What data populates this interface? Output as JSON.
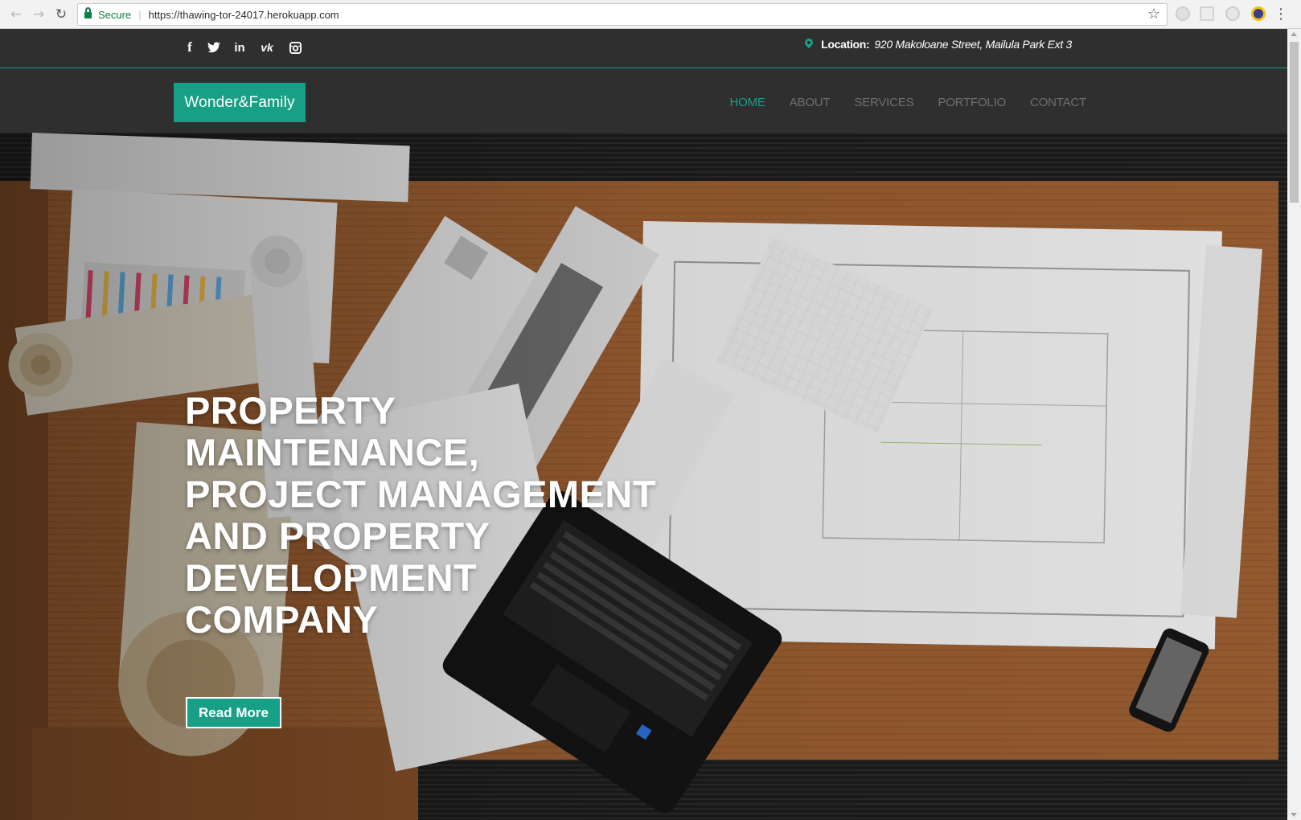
{
  "browser": {
    "secure_label": "Secure",
    "url": "https://thawing-tor-24017.herokuapp.com"
  },
  "topbar": {
    "social": [
      {
        "icon": "facebook-icon",
        "glyph": "f"
      },
      {
        "icon": "twitter-icon",
        "glyph": "🐦"
      },
      {
        "icon": "linkedin-icon",
        "glyph": "in"
      },
      {
        "icon": "vk-icon",
        "glyph": "vk"
      },
      {
        "icon": "instagram-icon",
        "glyph": "◙"
      }
    ],
    "location_label": "Location:",
    "location_value": "920 Makoloane Street, Mailula Park Ext 3"
  },
  "navbar": {
    "brand": "Wonder&Family",
    "menu": [
      {
        "label": "HOME",
        "active": true
      },
      {
        "label": "ABOUT",
        "active": false
      },
      {
        "label": "SERVICES",
        "active": false
      },
      {
        "label": "PORTFOLIO",
        "active": false
      },
      {
        "label": "CONTACT",
        "active": false
      }
    ]
  },
  "hero": {
    "title": " PROPERTY\nMAINTENANCE,\nPROJECT MANAGEMENT\nAND PROPERTY\nDEVELOPMENT\nCOMPANY",
    "button_label": "Read More"
  },
  "colors": {
    "accent": "#17a086",
    "bar": "#2f2f2f",
    "menu_inactive": "#6f6f6f"
  }
}
